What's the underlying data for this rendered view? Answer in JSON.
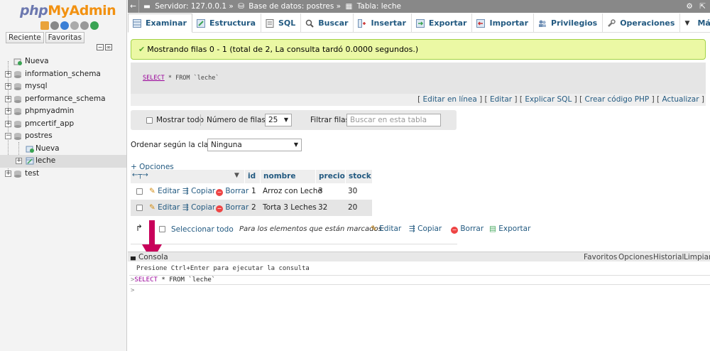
{
  "sidebar": {
    "logo": {
      "php": "php",
      "my": "My",
      "admin": "Admin"
    },
    "tabs": [
      "Reciente",
      "Favoritas"
    ],
    "tree": [
      {
        "label": "Nueva",
        "kind": "new"
      },
      {
        "label": "information_schema",
        "kind": "db"
      },
      {
        "label": "mysql",
        "kind": "db"
      },
      {
        "label": "performance_schema",
        "kind": "db"
      },
      {
        "label": "phpmyadmin",
        "kind": "db"
      },
      {
        "label": "pmcertif_app",
        "kind": "db"
      },
      {
        "label": "postres",
        "kind": "db-open"
      },
      {
        "label": "Nueva",
        "kind": "child-new"
      },
      {
        "label": "leche",
        "kind": "child-table"
      },
      {
        "label": "test",
        "kind": "db"
      }
    ]
  },
  "breadcrumb": {
    "server": "Servidor: 127.0.0.1 »",
    "database": "Base de datos: postres »",
    "table": "Tabla: leche"
  },
  "tabs": [
    {
      "label": "Examinar",
      "icon": "browse-icon",
      "active": true
    },
    {
      "label": "Estructura",
      "icon": "structure-icon"
    },
    {
      "label": "SQL",
      "icon": "sql-icon"
    },
    {
      "label": "Buscar",
      "icon": "search-icon"
    },
    {
      "label": "Insertar",
      "icon": "insert-icon"
    },
    {
      "label": "Exportar",
      "icon": "export-icon"
    },
    {
      "label": "Importar",
      "icon": "import-icon"
    },
    {
      "label": "Privilegios",
      "icon": "privileges-icon"
    },
    {
      "label": "Operaciones",
      "icon": "wrench-icon"
    },
    {
      "label": "Más",
      "icon": "caret-down-icon"
    }
  ],
  "success_message": "Mostrando filas 0 - 1 (total de 2, La consulta tardó 0.0000 segundos.)",
  "sql": {
    "select": "SELECT",
    "rest": " * FROM `leche`"
  },
  "sql_links": [
    "Editar en línea",
    "Editar",
    "Explicar SQL",
    "Crear código PHP",
    "Actualizar"
  ],
  "filter": {
    "show_all": "Mostrar todo",
    "rows_label": "Número de filas:",
    "rows_value": "25",
    "filter_label": "Filtrar filas:",
    "filter_placeholder": "Buscar en esta tabla"
  },
  "sort": {
    "label": "Ordenar según la clave:",
    "value": "Ninguna"
  },
  "options_link": "+ Opciones",
  "table": {
    "columns": [
      "id",
      "nombre",
      "precio",
      "stock"
    ],
    "action_labels": {
      "edit": "Editar",
      "copy": "Copiar",
      "delete": "Borrar"
    },
    "rows": [
      {
        "id": "1",
        "nombre": "Arroz con Leche",
        "precio": "3",
        "stock": "30"
      },
      {
        "id": "2",
        "nombre": "Torta 3 Leches",
        "precio": "32",
        "stock": "20"
      }
    ]
  },
  "bulk": {
    "select_all": "Seleccionar todo",
    "marked_label": "Para los elementos que están marcados:",
    "edit": "Editar",
    "copy": "Copiar",
    "delete": "Borrar",
    "export": "Exportar"
  },
  "console": {
    "title": "Consola",
    "links": [
      "Favoritos",
      "Opciones",
      "Historial",
      "Limpiar"
    ],
    "hint": "Presione Ctrl+Enter para ejecutar la consulta",
    "query_kw": "SELECT",
    "query_rest": " * FROM `leche`",
    "prompt": ">"
  },
  "colors": {
    "accent": "#235a81",
    "success_bg": "#ebf8a4",
    "annotation_arrow": "#c8005a"
  }
}
